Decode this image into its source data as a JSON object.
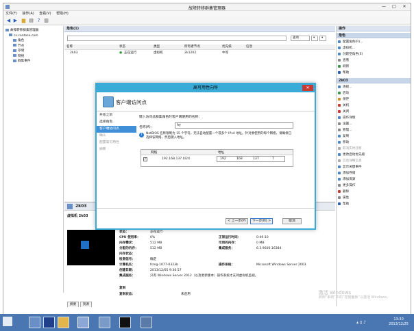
{
  "window": {
    "title": "故障转移群集管理器",
    "minimize": "—",
    "restore": "□",
    "close": "✕"
  },
  "menu": [
    "文件(F)",
    "操作(A)",
    "查看(V)",
    "帮助(H)"
  ],
  "tree": [
    "故障转移群集管理器",
    "cs.contoso.com",
    "角色",
    "节点",
    "存储",
    "网络",
    "群集事件"
  ],
  "center": {
    "header": "角色(1)",
    "query_label": "查询",
    "columns": [
      "名称",
      "状态",
      "类型",
      "所有者节点",
      "优先级",
      "信息"
    ],
    "rows": [
      {
        "name": "2k03",
        "status": "正在运行",
        "type": "虚拟机",
        "owner": "2k1202",
        "priority": "中等",
        "info": ""
      }
    ]
  },
  "bottom": {
    "vm_name": "2k03",
    "section_label": "虚拟机 2k03",
    "info_left": [
      {
        "k": "状态：",
        "v": "正在运行"
      },
      {
        "k": "CPU 使用率：",
        "v": "0%"
      },
      {
        "k": "内存需求：",
        "v": "512 MB"
      },
      {
        "k": "分配的内存：",
        "v": "512 MB"
      },
      {
        "k": "内存状态：",
        "v": ""
      },
      {
        "k": "检测信号：",
        "v": "确定"
      },
      {
        "k": "计算机名：",
        "v": "fsmg-1077-0323b"
      },
      {
        "k": "创建日期：",
        "v": "2013/12/05 9:36:57"
      },
      {
        "k": "集成服务：",
        "v": "只有 Windows Server 2012（以及更新版本）操作系统才支持虚拟机监视。"
      }
    ],
    "info_right": [
      {
        "k": "正常运行时间：",
        "v": "0:49:10"
      },
      {
        "k": "可用的内存：",
        "v": "0 MB"
      },
      {
        "k": "集成服务：",
        "v": "6.3.9600.16384"
      },
      {
        "k": "操作系统：",
        "v": "Microsoft Windows Server 2003"
      }
    ],
    "replication_label": "复制",
    "replication_state_label": "复制状态：",
    "replication_state": "未启用",
    "tabs": [
      "摘要",
      "资源"
    ]
  },
  "actions": {
    "section1": "角色",
    "items1": [
      "配置角色(R)...",
      "虚拟机...",
      "创建空角色(E)",
      "查看",
      "刷新",
      "帮助"
    ],
    "section2": "2k03",
    "items2": [
      "连接...",
      "启动",
      "保存",
      "关机",
      "关闭",
      "操作详情",
      "设置...",
      "管理...",
      "复制",
      "移动",
      "取消实时迁移",
      "更改启动优先级",
      "信息详细信息",
      "显示关键事件",
      "添加存储",
      "添加资源",
      "更多操作",
      "删除",
      "属性",
      "帮助"
    ]
  },
  "wizard": {
    "title": "高可用性向导",
    "header": "客户端访问点",
    "nav": [
      "开始之前",
      "选择角色",
      "客户端访问点",
      "确认",
      "配置高可用性",
      "摘要"
    ],
    "prompt": "键入访问此群集角色时客户端使用的名称：",
    "name_label": "名称(A)：",
    "name_value": "hy",
    "note": "NetBIOS 名称限制为 15 个字符。无法自动配置一个或多个 IPv4 地址。针对要使用的每个网络，请确保已选择该网络，然后键入地址。",
    "table_headers": [
      "网络",
      "地址"
    ],
    "network": "192.168.137.0/24",
    "address": [
      "192",
      "168",
      "137",
      "7"
    ],
    "back": "< 上一步(P)",
    "next": "下一步(N) >",
    "cancel": "取消"
  },
  "watermark": {
    "line1": "激活 Windows",
    "line2": "转到“系统”中的“控制面板”以激活 Windows。"
  },
  "clock": {
    "time": "13:30",
    "date": "2013/12/25"
  }
}
